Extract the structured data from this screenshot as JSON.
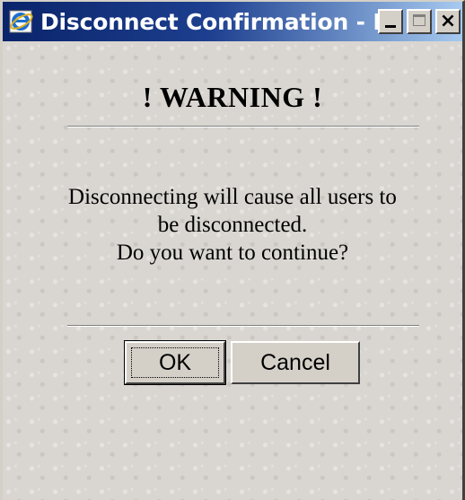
{
  "window": {
    "title": "Disconnect Confirmation - Mic...",
    "icon": "internet-explorer-icon",
    "controls": {
      "minimize": "minimize-icon",
      "maximize": "maximize-icon",
      "close_label": "×"
    }
  },
  "dialog": {
    "heading": "! WARNING !",
    "message_lines": [
      "Disconnecting will cause all users to",
      "be disconnected.",
      "Do you want to continue?"
    ],
    "ok_label": "OK",
    "cancel_label": "Cancel"
  },
  "colors": {
    "title_bar_start": "#0a246a",
    "title_bar_end": "#a6caf0",
    "face": "#d4d0c8",
    "content_bg": "#d9d6d1"
  }
}
